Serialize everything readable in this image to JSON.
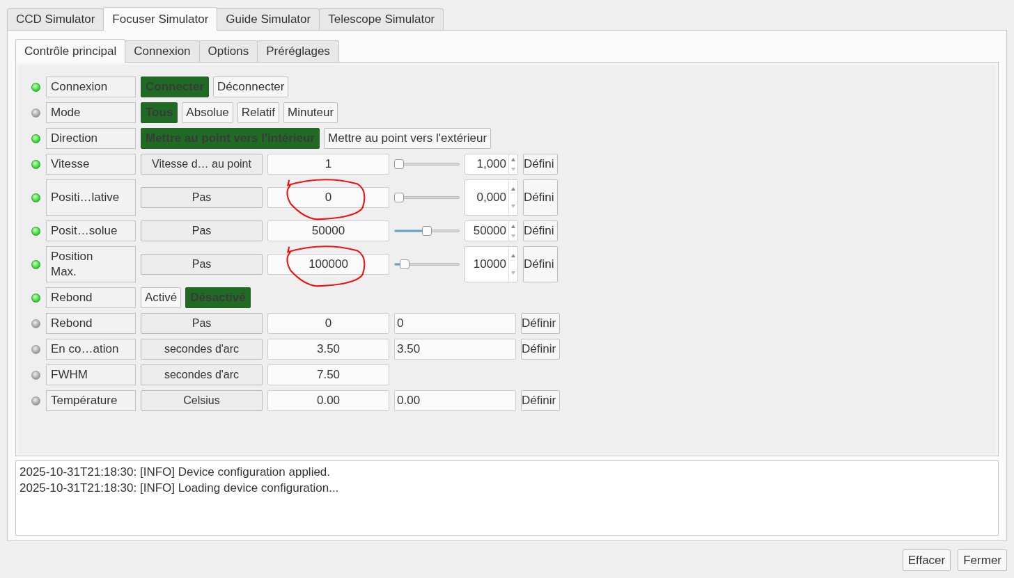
{
  "tabs": [
    {
      "label": "CCD Simulator",
      "selected": false
    },
    {
      "label": "Focuser Simulator",
      "selected": true
    },
    {
      "label": "Guide Simulator",
      "selected": false
    },
    {
      "label": "Telescope Simulator",
      "selected": false
    }
  ],
  "subtabs": [
    {
      "label": "Contrôle principal",
      "selected": true
    },
    {
      "label": "Connexion",
      "selected": false
    },
    {
      "label": "Options",
      "selected": false
    },
    {
      "label": "Préréglages",
      "selected": false
    }
  ],
  "properties": [
    {
      "kind": "switch",
      "lit": true,
      "label": "Connexion",
      "buttons": [
        {
          "label": "Connecter",
          "selected": true
        },
        {
          "label": "Déconnecter",
          "selected": false
        }
      ]
    },
    {
      "kind": "switch",
      "lit": false,
      "label": "Mode",
      "buttons": [
        {
          "label": "Tous",
          "selected": true
        },
        {
          "label": "Absolue",
          "selected": false
        },
        {
          "label": "Relatif",
          "selected": false
        },
        {
          "label": "Minuteur",
          "selected": false
        }
      ]
    },
    {
      "kind": "switch",
      "lit": true,
      "label": "Direction",
      "buttons": [
        {
          "label": "Mettre au point vers l'intérieur",
          "selected": true
        },
        {
          "label": "Mettre au point vers l'extérieur",
          "selected": false
        }
      ]
    },
    {
      "kind": "number",
      "lit": true,
      "label": "Vitesse",
      "unit": "Vitesse d… au point",
      "value": "1",
      "level": 0,
      "spin": "1,000",
      "button": "Défini",
      "tall": false,
      "circled": false
    },
    {
      "kind": "number",
      "lit": true,
      "label": "Positi…lative",
      "unit": "Pas",
      "value": "0",
      "level": 0,
      "spin": "0,000",
      "button": "Défini",
      "tall": true,
      "circled": true
    },
    {
      "kind": "number",
      "lit": true,
      "label": "Posit…solue",
      "unit": "Pas",
      "value": "50000",
      "level": 0.5,
      "spin": "50000",
      "button": "Défini",
      "tall": false,
      "circled": false
    },
    {
      "kind": "number",
      "lit": true,
      "label": "Position Max.",
      "unit": "Pas",
      "value": "100000",
      "level": 0.1,
      "spin": "10000",
      "button": "Défini",
      "tall": true,
      "circled": true
    },
    {
      "kind": "switch",
      "lit": true,
      "label": "Rebond",
      "buttons": [
        {
          "label": "Activé",
          "selected": false
        },
        {
          "label": "Désactivé",
          "selected": true
        }
      ]
    },
    {
      "kind": "text",
      "lit": false,
      "label": "Rebond",
      "unit": "Pas",
      "value": "0",
      "input": "0",
      "button": "Définir"
    },
    {
      "kind": "text",
      "lit": false,
      "label": "En co…ation",
      "unit": "secondes d'arc",
      "value": "3.50",
      "input": "3.50",
      "button": "Définir"
    },
    {
      "kind": "readonly",
      "lit": false,
      "label": "FWHM",
      "unit": "secondes d'arc",
      "value": "7.50"
    },
    {
      "kind": "text",
      "lit": false,
      "label": "Température",
      "unit": "Celsius",
      "value": "0.00",
      "input": "0.00",
      "button": "Définir"
    }
  ],
  "log": [
    "2025-10-31T21:18:30: [INFO] Device configuration applied.",
    "2025-10-31T21:18:30: [INFO] Loading device configuration..."
  ],
  "buttons": [
    "Effacer",
    "Fermer"
  ]
}
